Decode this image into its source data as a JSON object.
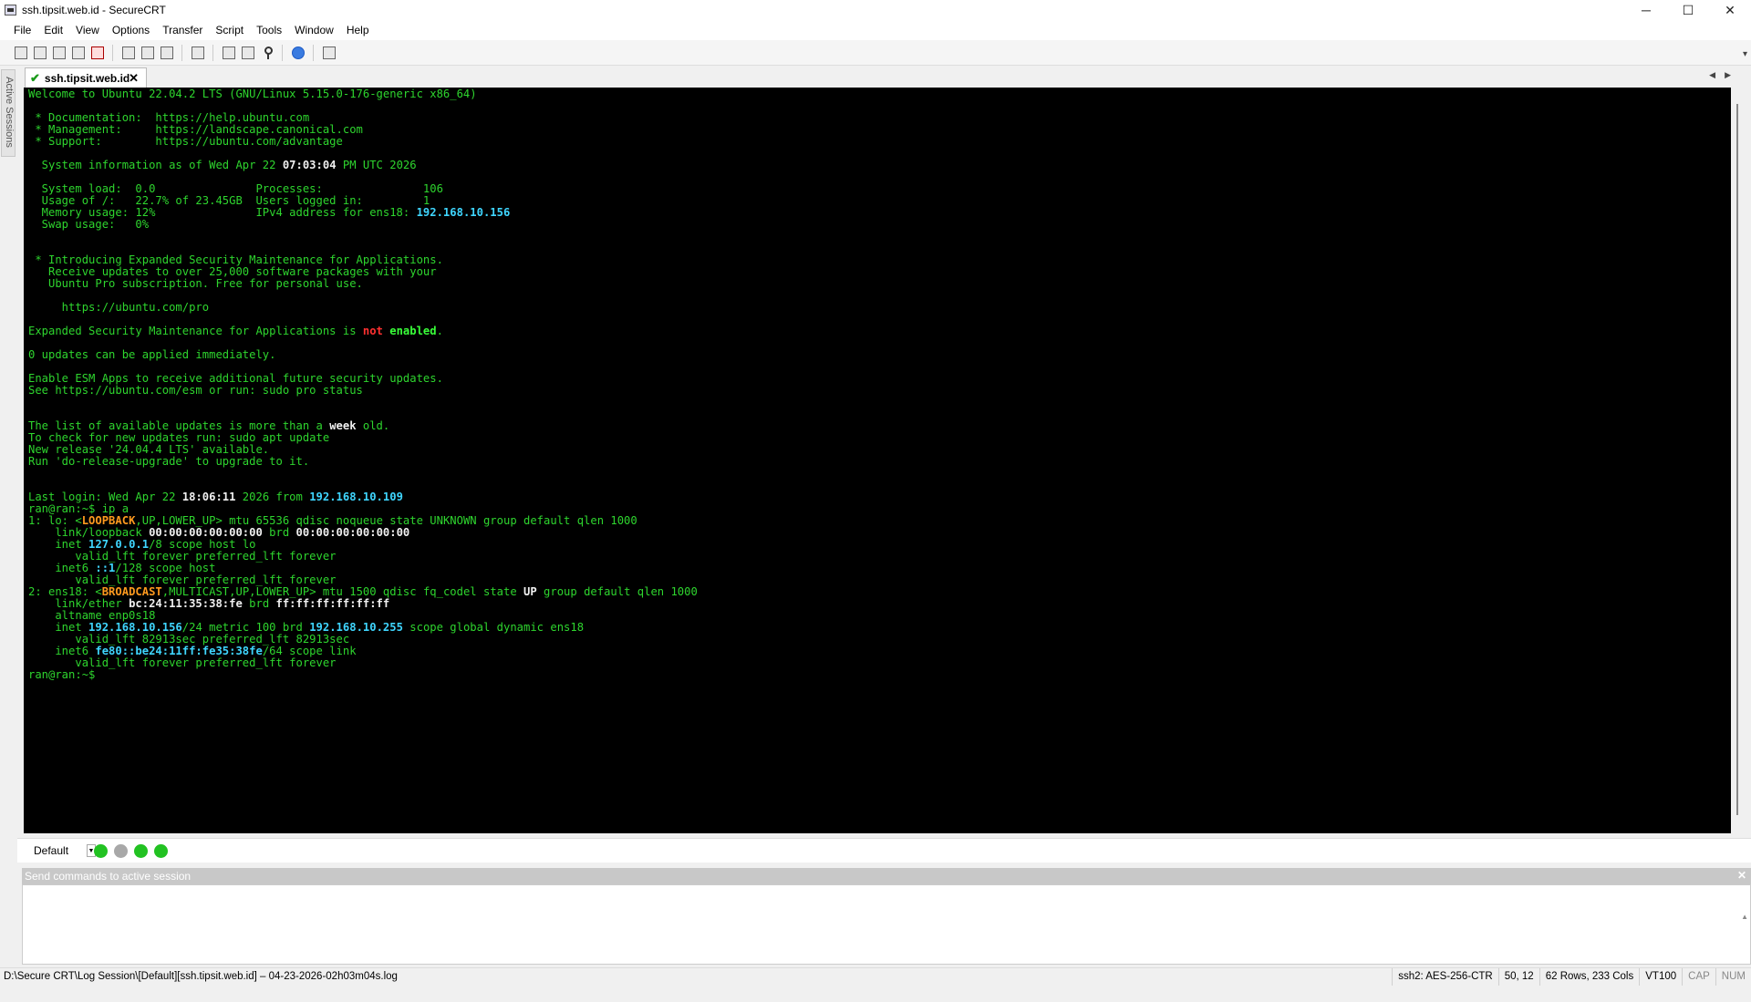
{
  "window": {
    "title": "ssh.tipsit.web.id - SecureCRT",
    "minimize": "─",
    "maximize": "☐",
    "close": "✕"
  },
  "menu": [
    "File",
    "Edit",
    "View",
    "Options",
    "Transfer",
    "Script",
    "Tools",
    "Window",
    "Help"
  ],
  "side_panel": {
    "label": "Active Sessions"
  },
  "tab": {
    "label": "ssh.tipsit.web.id",
    "check": "✔",
    "close": "✕",
    "nav": "◀▶"
  },
  "terminal": {
    "welcome": "Welcome to Ubuntu 22.04.2 LTS (GNU/Linux 5.15.0-176-generic x86_64)",
    "doc": " * Documentation:  https://help.ubuntu.com",
    "mgmt": " * Management:     https://landscape.canonical.com",
    "support": " * Support:        https://ubuntu.com/advantage",
    "sysinfo_pre": "  System information as of Wed Apr 22 ",
    "sysinfo_time": "07:03:04",
    "sysinfo_post": " PM UTC 2026",
    "load": "  System load:  0.0               Processes:               106",
    "usage": "  Usage of /:   22.7% of 23.45GB  Users logged in:         1",
    "mem_pre": "  Memory usage: 12%               IPv4 address for ens18: ",
    "mem_ip": "192.168.10.156",
    "swap": "  Swap usage:   0%",
    "esm1": " * Introducing Expanded Security Maintenance for Applications.",
    "esm2": "   Receive updates to over 25,000 software packages with your",
    "esm3": "   Ubuntu Pro subscription. Free for personal use.",
    "pro_url": "     https://ubuntu.com/pro",
    "esm_status_pre": "Expanded Security Maintenance for Applications is ",
    "esm_not": "not",
    "esm_enabled": "enabled",
    "esm_dot": ".",
    "updates": "0 updates can be applied immediately.",
    "enable1": "Enable ESM Apps to receive additional future security updates.",
    "enable2": "See https://ubuntu.com/esm or run: sudo pro status",
    "list_pre": "The list of available updates is more than a ",
    "list_week": "week",
    "list_post": " old.",
    "check_updates": "To check for new updates run: sudo apt update",
    "new_release": "New release '24.04.4 LTS' available.",
    "run_upgrade": "Run 'do-release-upgrade' to upgrade to it.",
    "last_login_pre": "Last login: Wed Apr 22 ",
    "last_login_time": "18:06:11",
    "last_login_mid": " 2026 from ",
    "last_login_ip": "192.168.10.109",
    "prompt1": "ran@ran:~$ ip a",
    "lo_pre": "1: lo: <",
    "lo_loopback": "LOOPBACK",
    "lo_flags": ",UP,LOWER_UP",
    "lo_post": "> mtu 65536 qdisc noqueue state UNKNOWN group default qlen 1000",
    "lo_link_pre": "    link/loopback ",
    "lo_mac": "00:00:00:00:00:00",
    "lo_brd": " brd ",
    "lo_brd_mac": "00:00:00:00:00:00",
    "lo_inet_pre": "    inet ",
    "lo_inet_ip": "127.0.0.1",
    "lo_inet_post": "/8 scope host lo",
    "lo_valid1": "       valid_lft forever preferred_lft forever",
    "lo_inet6_pre": "    inet6 ",
    "lo_inet6_ip": "::1",
    "lo_inet6_post": "/128 scope host",
    "lo_valid2": "       valid_lft forever preferred_lft forever",
    "ens_pre": "2: ens18: <",
    "ens_broadcast": "BROADCAST",
    "ens_flags": ",MULTICAST,UP,LOWER_UP",
    "ens_mid": "> mtu 1500 qdisc fq_codel state ",
    "ens_up": "UP",
    "ens_post": " group default qlen 1000",
    "ens_link_pre": "    link/ether ",
    "ens_mac": "bc:24:11:35:38:fe",
    "ens_brd": " brd ",
    "ens_brd_mac": "ff:ff:ff:ff:ff:ff",
    "ens_altname": "    altname enp0s18",
    "ens_inet_pre": "    inet ",
    "ens_inet_ip": "192.168.10.156",
    "ens_inet_mid": "/24 metric 100 brd ",
    "ens_inet_brd": "192.168.10.255",
    "ens_inet_post": " scope global dynamic ens18",
    "ens_valid1": "       valid_lft 82913sec preferred_lft 82913sec",
    "ens_inet6_pre": "    inet6 ",
    "ens_inet6_ip": "fe80::be24:11ff:fe35:38fe",
    "ens_inet6_post": "/64 scope link",
    "ens_valid2": "       valid_lft forever preferred_lft forever",
    "prompt2": "ran@ran:~$ "
  },
  "button_bar": {
    "selected": "Default",
    "arrow": "▼"
  },
  "command_window": {
    "title": "Send commands to active session",
    "close": "✕"
  },
  "status": {
    "log_path": "D:\\Secure CRT\\Log Session\\[Default][ssh.tipsit.web.id] – 04-23-2026-02h03m04s.log",
    "cipher": "ssh2: AES-256-CTR",
    "cursor": "50, 12",
    "size": "62 Rows, 233 Cols",
    "emulation": "VT100",
    "cap": "CAP",
    "num": "NUM"
  },
  "colors": {
    "terminal_bg": "#000000",
    "terminal_fg": "#2ed52e",
    "highlight_white": "#f0f0f0",
    "highlight_cyan": "#3fd6ff",
    "highlight_red": "#ff3030",
    "highlight_orange": "#ff9a1f",
    "dot_green": "#22c222",
    "dot_gray": "#a8a8a8"
  }
}
